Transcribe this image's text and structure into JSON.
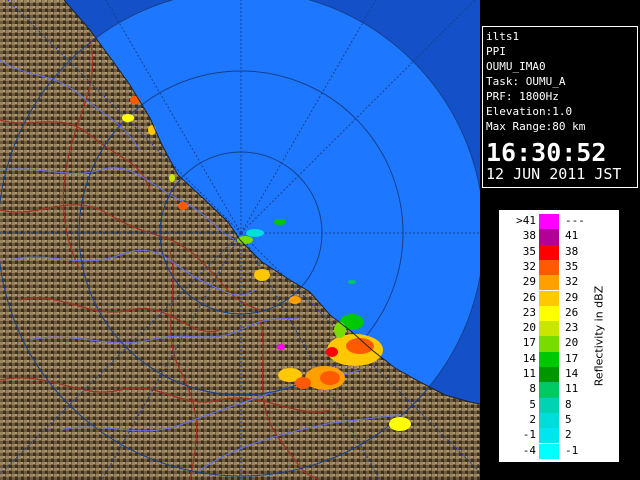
{
  "info": {
    "lines": [
      "ilts1",
      "PPI",
      "OUMU_IMA0",
      "Task: OUMU_A",
      "PRF: 1800Hz",
      "Elevation:1.0",
      "Max Range:80 km"
    ],
    "time": "16:30:52",
    "date": "12 JUN 2011 JST"
  },
  "legend": {
    "title": "Reflectivity in dBZ",
    "rows": [
      {
        "low": ">41",
        "high": "---",
        "color": "#ff00ff"
      },
      {
        "low": "38",
        "high": "41",
        "color": "#b40096"
      },
      {
        "low": "35",
        "high": "38",
        "color": "#ff0000"
      },
      {
        "low": "32",
        "high": "35",
        "color": "#ff5a00"
      },
      {
        "low": "29",
        "high": "32",
        "color": "#ffa000"
      },
      {
        "low": "26",
        "high": "29",
        "color": "#ffc800"
      },
      {
        "low": "23",
        "high": "26",
        "color": "#ffff00"
      },
      {
        "low": "20",
        "high": "23",
        "color": "#c8e600"
      },
      {
        "low": "17",
        "high": "20",
        "color": "#78dc00"
      },
      {
        "low": "14",
        "high": "17",
        "color": "#00c800"
      },
      {
        "low": "11",
        "high": "14",
        "color": "#009600"
      },
      {
        "low": "8",
        "high": "11",
        "color": "#00c864"
      },
      {
        "low": "5",
        "high": "8",
        "color": "#00d2b4"
      },
      {
        "low": "2",
        "high": "5",
        "color": "#00dcdc"
      },
      {
        "low": "-1",
        "high": "2",
        "color": "#00e6f0"
      },
      {
        "low": "-4",
        "high": "-1",
        "color": "#00ffff"
      }
    ]
  },
  "colors": {
    "sea": "#1e78ff",
    "sea_out_of_range": "#1450c8",
    "land": "#7a6440",
    "rivers": "#6070f0",
    "prefecture_borders": "#a03020"
  }
}
